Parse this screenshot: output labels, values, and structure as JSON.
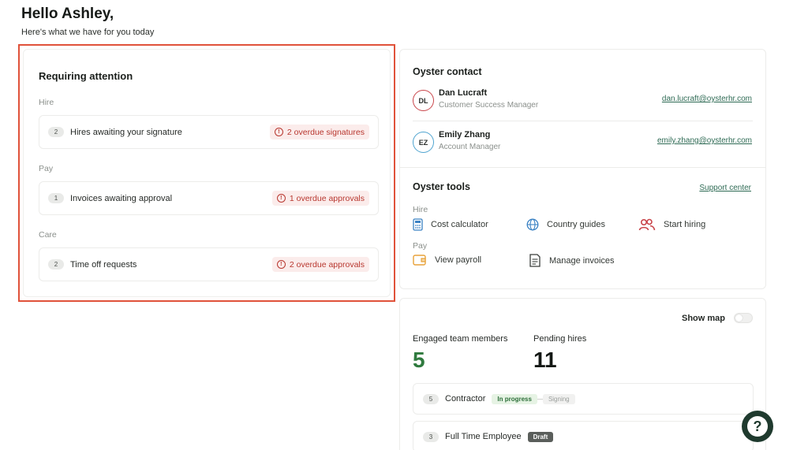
{
  "header": {
    "greeting": "Hello Ashley,",
    "subtitle": "Here's what we have for you today"
  },
  "attention": {
    "title": "Requiring attention",
    "sections": [
      {
        "label": "Hire",
        "count": "2",
        "item": "Hires awaiting your signature",
        "overdue": "2 overdue signatures"
      },
      {
        "label": "Pay",
        "count": "1",
        "item": "Invoices awaiting approval",
        "overdue": "1 overdue approvals"
      },
      {
        "label": "Care",
        "count": "2",
        "item": "Time off requests",
        "overdue": "2 overdue approvals"
      }
    ],
    "warn_glyph": "!"
  },
  "contact": {
    "title": "Oyster contact",
    "people": [
      {
        "initials": "DL",
        "name": "Dan Lucraft",
        "role": "Customer Success Manager",
        "email": "dan.lucraft@oysterhr.com"
      },
      {
        "initials": "EZ",
        "name": "Emily Zhang",
        "role": "Account Manager",
        "email": "emily.zhang@oysterhr.com"
      }
    ]
  },
  "tools": {
    "title": "Oyster tools",
    "support_link": "Support center",
    "hire_label": "Hire",
    "pay_label": "Pay",
    "hire_tools": [
      {
        "label": "Cost calculator",
        "icon": "calculator-icon"
      },
      {
        "label": "Country guides",
        "icon": "globe-icon"
      },
      {
        "label": "Start hiring",
        "icon": "people-icon"
      }
    ],
    "pay_tools": [
      {
        "label": "View payroll",
        "icon": "wallet-icon"
      },
      {
        "label": "Manage invoices",
        "icon": "invoice-icon"
      }
    ]
  },
  "stats": {
    "show_map_label": "Show map",
    "engaged_label": "Engaged team members",
    "engaged_value": "5",
    "pending_label": "Pending hires",
    "pending_value": "11",
    "hires": [
      {
        "count": "5",
        "label": "Contractor",
        "status": "In progress",
        "next_step": "Signing"
      },
      {
        "count": "3",
        "label": "Full Time Employee",
        "status": "Draft"
      }
    ]
  },
  "help": {
    "glyph": "?"
  },
  "colors": {
    "highlight_border": "#e0523a",
    "overdue_text": "#b8372f",
    "overdue_bg": "#fbeceb",
    "engaged_green": "#2f7a3e",
    "link_green": "#2f6b55",
    "help_button": "#1f3a2e"
  }
}
